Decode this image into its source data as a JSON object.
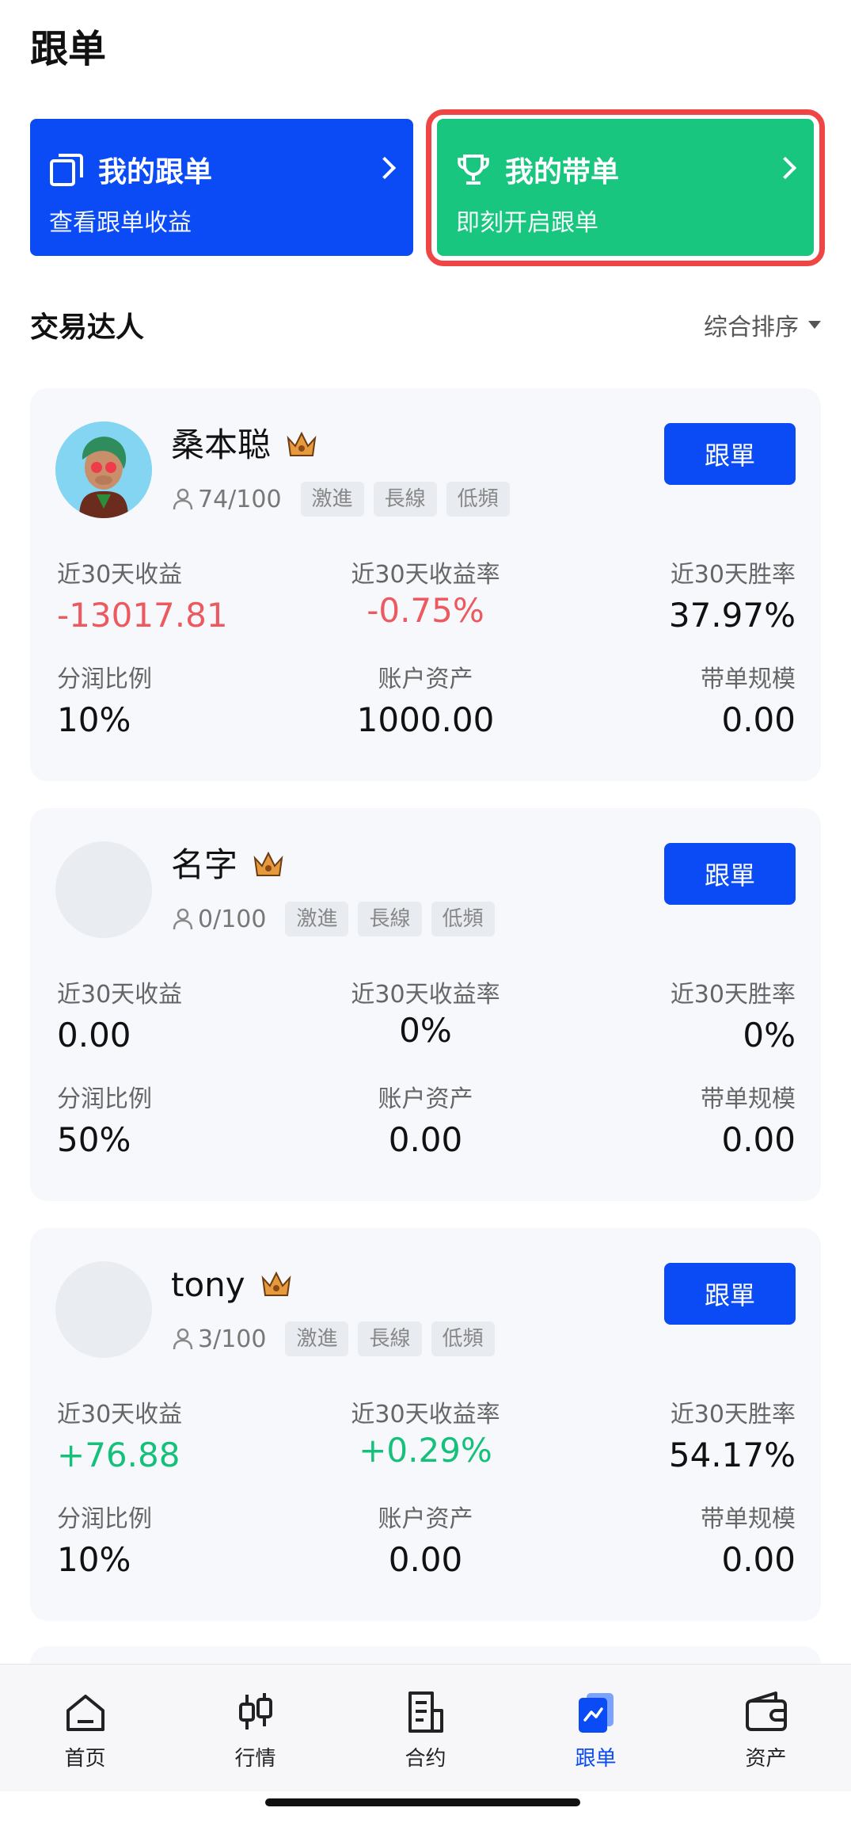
{
  "page_title": "跟单",
  "banners": {
    "my_follow": {
      "title": "我的跟单",
      "subtitle": "查看跟单收益"
    },
    "my_lead": {
      "title": "我的带单",
      "subtitle": "即刻开启跟单"
    }
  },
  "section": {
    "title": "交易达人",
    "sort_label": "综合排序"
  },
  "stat_labels": {
    "profit_30d": "近30天收益",
    "profit_rate_30d": "近30天收益率",
    "win_rate_30d": "近30天胜率",
    "share_ratio": "分润比例",
    "account_assets": "账户资产",
    "lead_scale": "带单规模"
  },
  "follow_button_label": "跟單",
  "traders": [
    {
      "name": "桑本聪",
      "followers": "74/100",
      "tags": [
        "激進",
        "長線",
        "低頻"
      ],
      "profit_30d": "-13017.81",
      "profit_rate_30d": "-0.75%",
      "win_rate_30d": "37.97%",
      "share_ratio": "10%",
      "account_assets": "1000.00",
      "lead_scale": "0.00",
      "trend": "negative"
    },
    {
      "name": "名字",
      "followers": "0/100",
      "tags": [
        "激進",
        "長線",
        "低頻"
      ],
      "profit_30d": "0.00",
      "profit_rate_30d": "0%",
      "win_rate_30d": "0%",
      "share_ratio": "50%",
      "account_assets": "0.00",
      "lead_scale": "0.00",
      "trend": "neutral"
    },
    {
      "name": "tony",
      "followers": "3/100",
      "tags": [
        "激進",
        "長線",
        "低頻"
      ],
      "profit_30d": "+76.88",
      "profit_rate_30d": "+0.29%",
      "win_rate_30d": "54.17%",
      "share_ratio": "10%",
      "account_assets": "0.00",
      "lead_scale": "0.00",
      "trend": "positive"
    }
  ],
  "tabbar": [
    {
      "label": "首页",
      "icon": "home-icon"
    },
    {
      "label": "行情",
      "icon": "candlestick-icon"
    },
    {
      "label": "合约",
      "icon": "document-icon"
    },
    {
      "label": "跟单",
      "icon": "copy-trade-icon",
      "active": true
    },
    {
      "label": "资产",
      "icon": "wallet-icon"
    }
  ],
  "colors": {
    "primary_blue": "#0a4bf5",
    "green": "#18c67f",
    "negative": "#ec5a5f",
    "positive": "#15c07a",
    "highlight_border": "#ef4545"
  }
}
